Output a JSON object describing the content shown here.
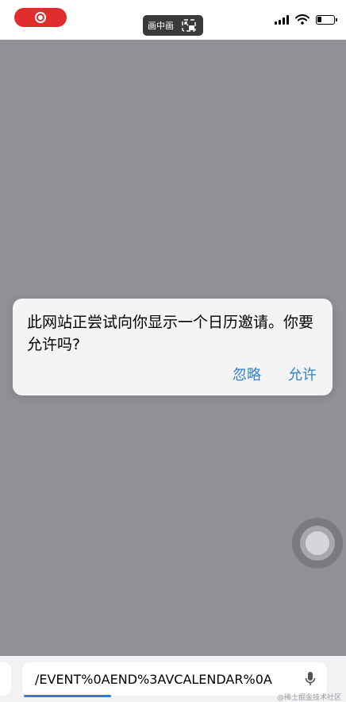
{
  "status_bar": {
    "pip_label": "画中画",
    "icons": [
      "record-icon",
      "pip-icon",
      "signal-icon",
      "wifi-icon",
      "battery-icon"
    ],
    "record_color": "#e02c2c"
  },
  "dialog": {
    "message": "此网站正尝试向你显示一个日历邀请。你要允许吗?",
    "ignore_label": "忽略",
    "allow_label": "允许",
    "button_color": "#2f80d6"
  },
  "address_bar": {
    "text": "/EVENT%0AEND%3AVCALENDAR%0A",
    "mic_icon": "microphone-icon",
    "progress": 0.27
  },
  "watermark": "@稀土掘金技术社区",
  "overlay_color": "#919094"
}
